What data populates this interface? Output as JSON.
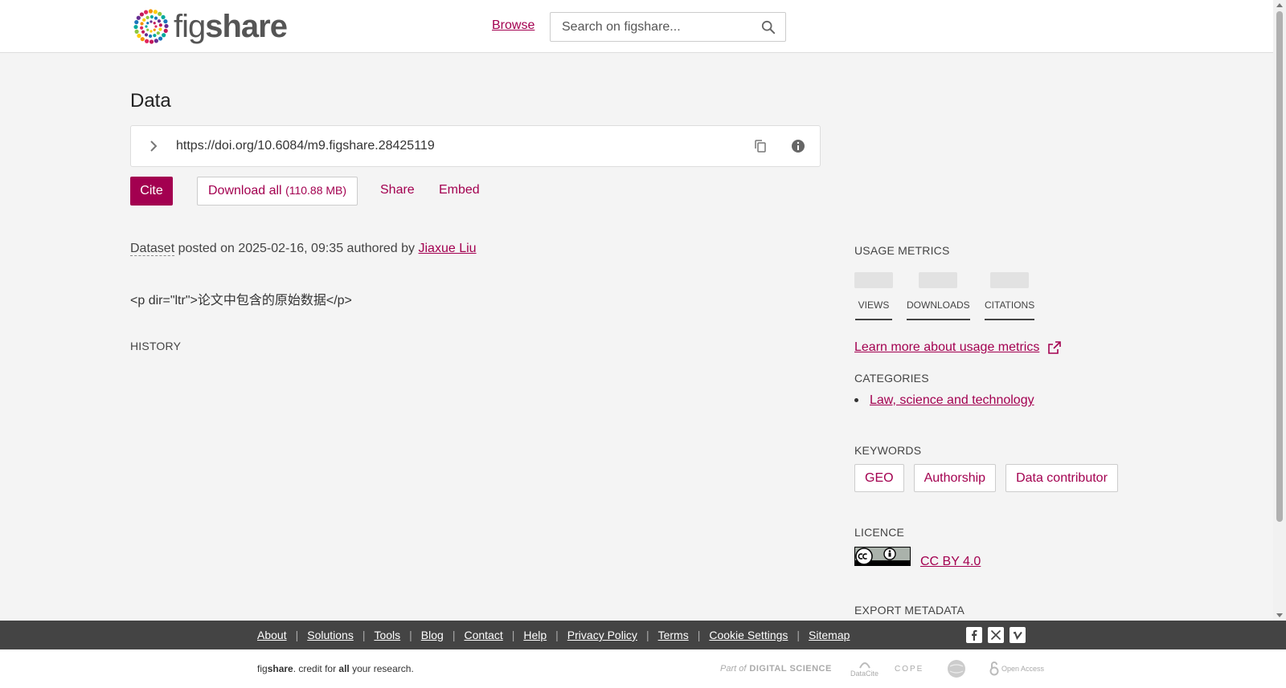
{
  "header": {
    "logo_text_light": "fig",
    "logo_text_bold": "share",
    "browse": "Browse",
    "search_placeholder": "Search on figshare..."
  },
  "item": {
    "title": "Data",
    "doi": "https://doi.org/10.6084/m9.figshare.28425119",
    "actions": {
      "cite": "Cite",
      "download": "Download all",
      "download_size": "(110.88 MB)",
      "share": "Share",
      "embed": "Embed"
    },
    "type": "Dataset",
    "posted_text": "posted on 2025-02-16, 09:35 authored by",
    "author": "Jiaxue Liu",
    "description": "<p dir=\"ltr\">论文中包含的原始数据</p>",
    "history_heading": "HISTORY"
  },
  "sidebar": {
    "usage_heading": "USAGE METRICS",
    "metrics": [
      {
        "label": "VIEWS"
      },
      {
        "label": "DOWNLOADS"
      },
      {
        "label": "CITATIONS"
      }
    ],
    "learn_more": "Learn more about usage metrics",
    "categories_heading": "CATEGORIES",
    "categories": [
      "Law, science and technology"
    ],
    "keywords_heading": "KEYWORDS",
    "keywords": [
      "GEO",
      "Authorship",
      "Data contributor"
    ],
    "licence_heading": "LICENCE",
    "licence": "CC BY 4.0",
    "export_heading": "EXPORT METADATA"
  },
  "footer": {
    "links": [
      "About",
      "Solutions",
      "Tools",
      "Blog",
      "Contact",
      "Help",
      "Privacy Policy",
      "Terms",
      "Cookie Settings",
      "Sitemap"
    ],
    "tagline_fig": "fig",
    "tagline_share": "share",
    "tagline_mid": ". credit for ",
    "tagline_all": "all",
    "tagline_end": " your research.",
    "partners": [
      "Part of",
      "DIGITAL SCIENCE",
      "DataCite",
      "COPE",
      "Open Access"
    ]
  },
  "colors": {
    "brand": "#a30050",
    "footer_bg": "#444444",
    "page_bg": "#f4f4f4"
  }
}
